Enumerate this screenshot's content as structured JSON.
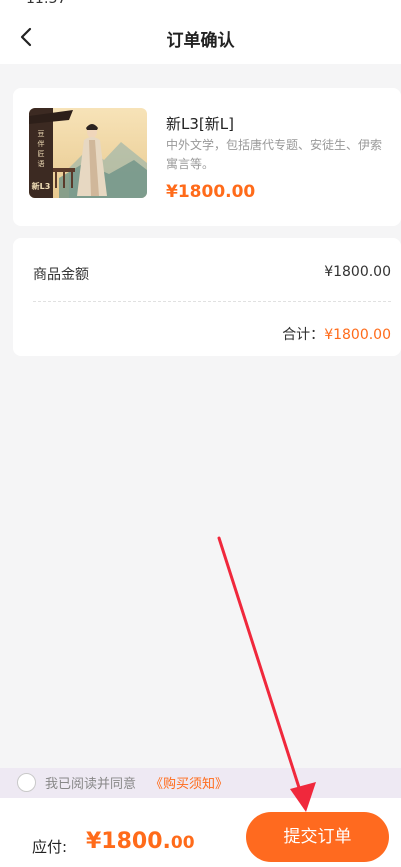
{
  "nav": {
    "title": "订单确认"
  },
  "product": {
    "title": "新L3[新L]",
    "description": "中外文学，包括唐代专题、安徒生、伊索寓言等。",
    "price": "¥1800.00",
    "thumb_text": "新L3"
  },
  "amount": {
    "label": "商品金额",
    "value": "¥1800.00",
    "total_label": "合计：",
    "total_value": "¥1800.00"
  },
  "agreement": {
    "text": "我已阅读并同意",
    "link": "《购买须知》"
  },
  "footer": {
    "pay_label": "应付:",
    "pay_amount_main": "¥1800.",
    "pay_amount_decimal": "00",
    "submit_label": "提交订单"
  },
  "colors": {
    "accent": "#ff6a1f",
    "annotation_arrow": "#f0283c"
  },
  "icons": {
    "back": "chevron-left-icon",
    "radio": "radio-unchecked-icon",
    "annotation": "red-arrow-annotation"
  }
}
